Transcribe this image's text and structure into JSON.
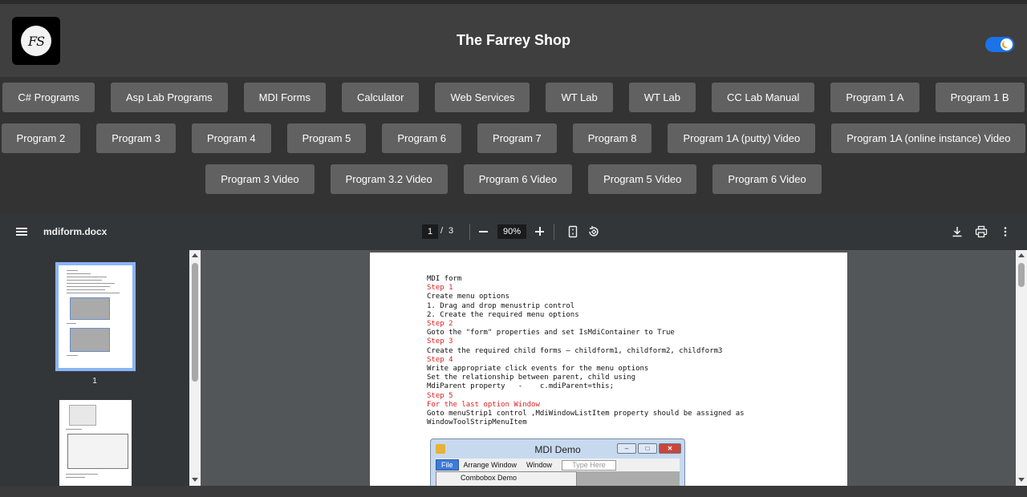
{
  "header": {
    "logo_text": "FS",
    "title": "The Farrey Shop",
    "theme_toggle": "dark-mode-toggle"
  },
  "nav": {
    "row1": [
      "C# Programs",
      "Asp Lab Programs",
      "MDI Forms",
      "Calculator",
      "Web Services",
      "WT Lab",
      "WT Lab",
      "CC Lab Manual",
      "Program 1 A",
      "Program 1 B"
    ],
    "row2": [
      "Program 2",
      "Program 3",
      "Program 4",
      "Program 5",
      "Program 6",
      "Program 7",
      "Program 8",
      "Program 1A (putty) Video",
      "Program 1A (online instance) Video"
    ],
    "row3": [
      "Program 3 Video",
      "Program 3.2 Video",
      "Program 6 Video",
      "Program 5 Video",
      "Program 6 Video"
    ]
  },
  "viewer": {
    "filename": "mdiform.docx",
    "current_page": "1",
    "page_separator": "/",
    "total_pages": "3",
    "zoom": "90%",
    "thumbnail_label": "1",
    "icons": [
      "menu-icon",
      "zoom-out-icon",
      "zoom-in-icon",
      "fit-page-icon",
      "rotate-icon",
      "download-icon",
      "print-icon",
      "more-icon"
    ]
  },
  "document": {
    "lines": [
      {
        "text": "MDI form",
        "red": false
      },
      {
        "text": "Step 1",
        "red": true
      },
      {
        "text": "Create menu options",
        "red": false
      },
      {
        "text": "1. Drag and drop menustrip control",
        "red": false
      },
      {
        "text": "2. Create the required menu options",
        "red": false
      },
      {
        "text": "Step 2",
        "red": true
      },
      {
        "text": "Goto the \"form\" properties and set IsMdiContainer to True",
        "red": false
      },
      {
        "text": "Step 3",
        "red": true
      },
      {
        "text": "Create the required child forms – childform1, childform2, childform3",
        "red": false
      },
      {
        "text": "Step 4",
        "red": true
      },
      {
        "text": "Write appropriate click events for the menu options",
        "red": false
      },
      {
        "text": "Set the relationship between parent, child using",
        "red": false
      },
      {
        "text": "MdiParent property   -    c.mdiParent=this;",
        "red": false
      },
      {
        "text": "Step 5",
        "red": true
      },
      {
        "text": "For the last option Window",
        "red": true
      },
      {
        "text": "Goto menuStrip1 control ,MdiWindowListItem property should be assigned as",
        "red": false
      },
      {
        "text": "WindowToolStripMenuItem",
        "red": false
      }
    ],
    "screenshot": {
      "title": "MDI Demo",
      "menu": [
        "File",
        "Arrange Window",
        "Window"
      ],
      "type_here": "Type Here",
      "submenu_item": "Combobox Demo"
    }
  },
  "colors": {
    "header_bg": "#3f3f3f",
    "nav_button": "#616161",
    "toolbar_bg": "#323639",
    "toggle_accent": "#1a73e8",
    "step_red": "#dd2222"
  }
}
